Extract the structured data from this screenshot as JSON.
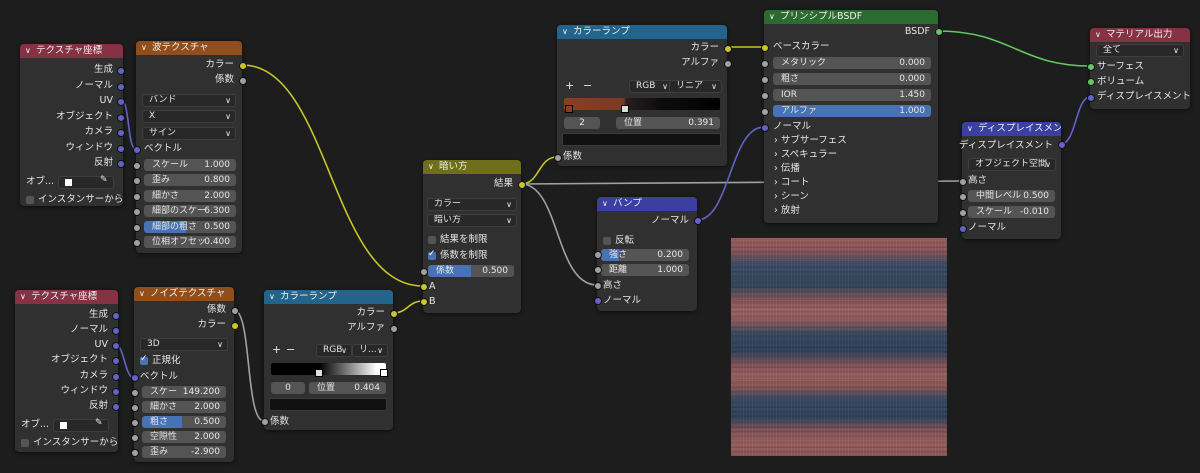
{
  "tc1": {
    "title": "テクスチャ座標",
    "outputs": [
      "生成",
      "ノーマル",
      "UV",
      "オブジェクト",
      "カメラ",
      "ウィンドウ",
      "反射"
    ],
    "object_label": "オブ...",
    "instancer": "インスタンサーから"
  },
  "wave": {
    "title": "波テクスチャ",
    "outputs": [
      "カラー",
      "係数"
    ],
    "dd1": "バンド",
    "dd2": "X",
    "dd3": "サイン",
    "vector": "ベクトル",
    "fields": [
      {
        "label": "スケール",
        "value": "1.000"
      },
      {
        "label": "歪み",
        "value": "0.800"
      },
      {
        "label": "細かさ",
        "value": "2.000"
      },
      {
        "label": "細部のスケー",
        "value": "6.300"
      },
      {
        "label": "細部の粗さ",
        "value": "0.500"
      },
      {
        "label": "位相オフセッ",
        "value": "0.400"
      }
    ]
  },
  "tc2": {
    "title": "テクスチャ座標",
    "outputs": [
      "生成",
      "ノーマル",
      "UV",
      "オブジェクト",
      "カメラ",
      "ウィンドウ",
      "反射"
    ],
    "object_label": "オブ...",
    "instancer": "インスタンサーから"
  },
  "noise": {
    "title": "ノイズテクスチャ",
    "outputs": [
      "係数",
      "カラー"
    ],
    "dd": "3D",
    "normalize": "正規化",
    "vector": "ベクトル",
    "fields": [
      {
        "label": "スケー",
        "value": "149.200"
      },
      {
        "label": "細かさ",
        "value": "2.000"
      },
      {
        "label": "粗さ",
        "value": "0.500"
      },
      {
        "label": "空隙性",
        "value": "2.000"
      },
      {
        "label": "歪み",
        "value": "-2.900"
      }
    ]
  },
  "ramp2": {
    "title": "カラーランプ",
    "outputs": [
      "カラー",
      "アルファ"
    ],
    "plus": "+",
    "minus": "−",
    "mode": "RGB",
    "interp": "リ...",
    "index": "0",
    "pos_label": "位置",
    "pos_value": "0.404",
    "input": "係数"
  },
  "ramp1": {
    "title": "カラーランプ",
    "outputs": [
      "カラー",
      "アルファ"
    ],
    "plus": "+",
    "minus": "−",
    "mode": "RGB",
    "interp": "リニア",
    "index": "2",
    "pos_label": "位置",
    "pos_value": "0.391",
    "input": "係数"
  },
  "mix": {
    "title": "暗い方",
    "output": "結果",
    "dd1": "カラー",
    "dd2": "暗い方",
    "clamp_result": "結果を制限",
    "clamp_factor": "係数を制限",
    "factor_label": "係数",
    "factor_value": "0.500",
    "in_a": "A",
    "in_b": "B"
  },
  "bump": {
    "title": "バンプ",
    "output": "ノーマル",
    "invert": "反転",
    "strength_label": "強さ",
    "strength_value": "0.200",
    "distance_label": "距離",
    "distance_value": "1.000",
    "height": "高さ",
    "normal": "ノーマル"
  },
  "bsdf": {
    "title": "プリンシプルBSDF",
    "output": "BSDF",
    "base_color": "ベースカラー",
    "fields": [
      {
        "label": "メタリック",
        "value": "0.000"
      },
      {
        "label": "粗さ",
        "value": "0.000"
      },
      {
        "label": "IOR",
        "value": "1.450"
      },
      {
        "label": "アルファ",
        "value": "1.000"
      }
    ],
    "normal": "ノーマル",
    "panels": [
      "サブサーフェス",
      "スペキュラー",
      "伝播",
      "コート",
      "シーン",
      "放射"
    ]
  },
  "disp": {
    "title": "ディスプレイスメント",
    "output": "ディスプレイスメント",
    "space": "オブジェクト空間",
    "height": "高さ",
    "mid_label": "中間レベル",
    "mid_value": "0.500",
    "scale_label": "スケール",
    "scale_value": "-0.010",
    "normal": "ノーマル"
  },
  "out": {
    "title": "マテリアル出力",
    "target": "全て",
    "inputs": [
      "サーフェス",
      "ボリューム",
      "ディスプレイスメント"
    ]
  },
  "colors": {
    "vector_socket": "#6363c7",
    "color_socket": "#c7c729",
    "float_socket": "#a1a1a1",
    "shader_socket": "#63c763",
    "accent": "#4772b3"
  }
}
